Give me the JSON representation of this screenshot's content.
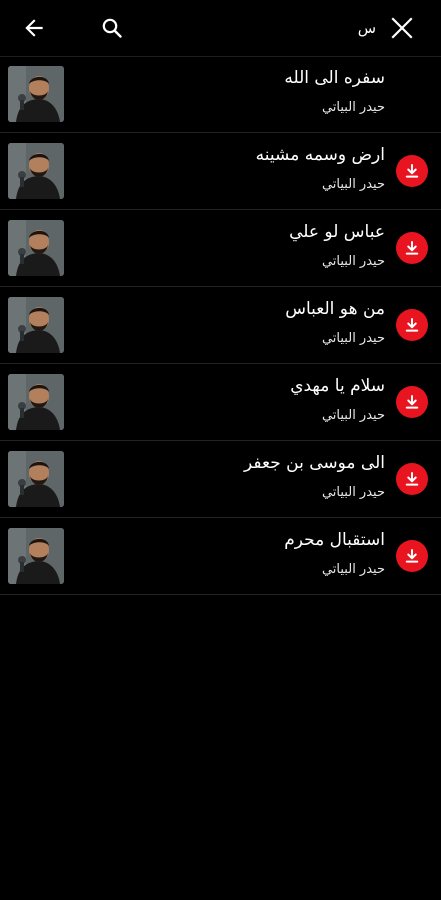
{
  "search": {
    "value": "س",
    "placeholder": ""
  },
  "icons": {
    "back": "arrow-back-icon",
    "search": "search-icon",
    "close": "close-icon",
    "download": "download-icon"
  },
  "colors": {
    "background": "#000000",
    "accent": "#e8141f",
    "text": "#ffffff",
    "divider": "#232323"
  },
  "results": [
    {
      "title": "سفره الى الله",
      "artist": "حيدر البياتي",
      "downloadable": false
    },
    {
      "title": "ارض وسمه مشينه",
      "artist": "حيدر البياتي",
      "downloadable": true
    },
    {
      "title": "عباس لو علي",
      "artist": "حيدر البياتي",
      "downloadable": true
    },
    {
      "title": "من هو العباس",
      "artist": "حيدر البياتي",
      "downloadable": true
    },
    {
      "title": "سلام يا مهدي",
      "artist": "حيدر البياتي",
      "downloadable": true
    },
    {
      "title": "الى موسى بن جعفر",
      "artist": "حيدر البياتي",
      "downloadable": true
    },
    {
      "title": "استقبال محرم",
      "artist": "حيدر البياتي",
      "downloadable": true
    }
  ]
}
